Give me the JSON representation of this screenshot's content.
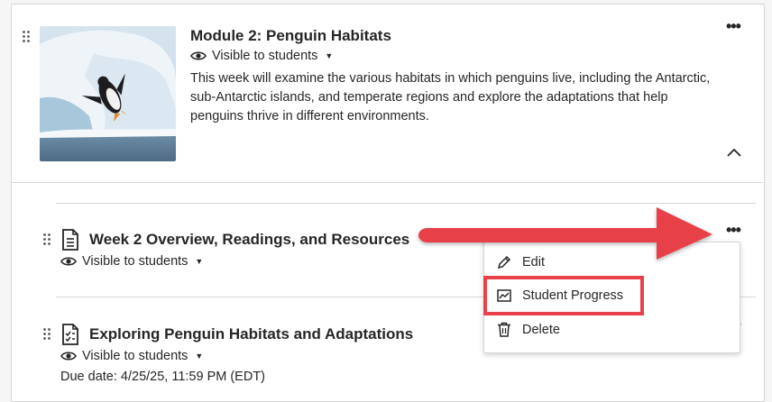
{
  "module": {
    "title": "Module 2: Penguin Habitats",
    "visibility": "Visible to students",
    "description": "This week will examine the various habitats in which penguins live, including the Antarctic, sub-Antarctic islands, and temperate regions and explore the adaptations that help penguins thrive in different environments.",
    "thumbnail_icon": "penguin-on-ice-image"
  },
  "items": [
    {
      "title": "Week 2 Overview, Readings, and Resources",
      "visibility": "Visible to students",
      "icon": "document-icon"
    },
    {
      "title": "Exploring Penguin Habitats and Adaptations",
      "visibility": "Visible to students",
      "due": "Due date: 4/25/25, 11:59 PM (EDT)",
      "icon": "assignment-icon"
    }
  ],
  "menu": {
    "items": [
      {
        "label": "Edit",
        "icon": "pencil-icon"
      },
      {
        "label": "Student Progress",
        "icon": "student-progress-icon"
      },
      {
        "label": "Delete",
        "icon": "trash-icon"
      }
    ]
  },
  "colors": {
    "annotation": "#e8414a",
    "text": "#262626",
    "border": "#d6d6d6"
  }
}
